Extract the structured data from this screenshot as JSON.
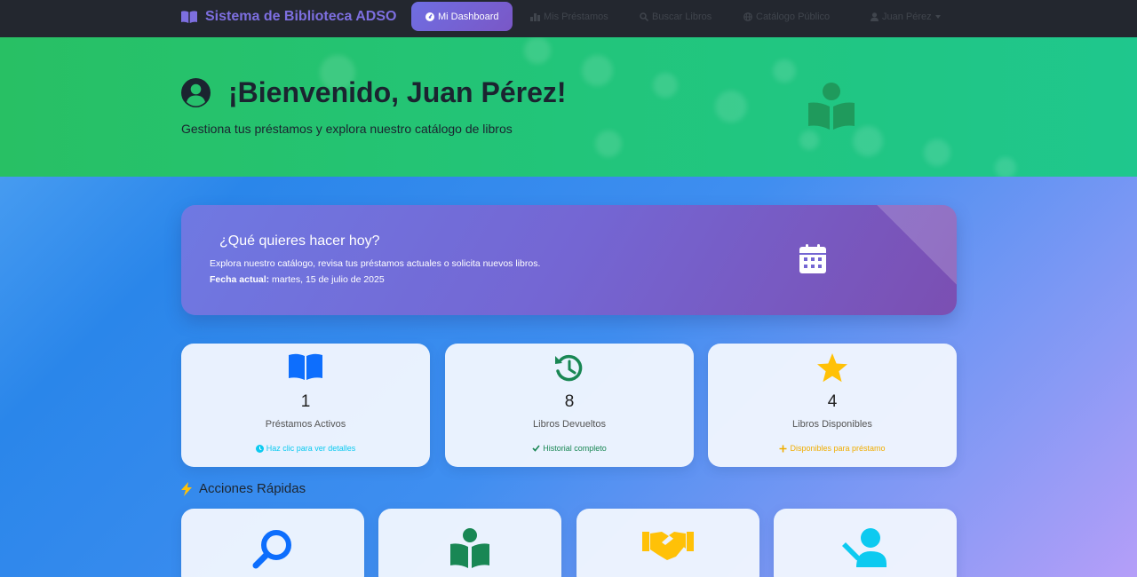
{
  "navbar": {
    "brand": "Sistema de Biblioteca ADSO",
    "items": [
      {
        "label": "Mi Dashboard",
        "icon": "dashboard-icon",
        "active": true
      },
      {
        "label": "Mis Préstamos",
        "icon": "chart-icon"
      },
      {
        "label": "Buscar Libros",
        "icon": "search-icon"
      },
      {
        "label": "Catálogo Público",
        "icon": "globe-icon"
      },
      {
        "label": "Juan Pérez",
        "icon": "user-icon",
        "dropdown": true
      }
    ]
  },
  "hero": {
    "title": "¡Bienvenido, Juan Pérez!",
    "subtitle": "Gestiona tus préstamos y explora nuestro catálogo de libros"
  },
  "welcome": {
    "title": "¿Qué quieres hacer hoy?",
    "text": "Explora nuestro catálogo, revisa tus préstamos actuales o solicita nuevos libros.",
    "date_label": "Fecha actual:",
    "date_value": "martes, 15 de julio de 2025"
  },
  "stats": [
    {
      "value": "1",
      "label": "Préstamos Activos",
      "footer": "Haz clic para ver detalles",
      "icon": "book-open-icon",
      "color": "#0d6efd",
      "footer_color": "#0dcaf0"
    },
    {
      "value": "8",
      "label": "Libros Devueltos",
      "footer": "Historial completo",
      "icon": "history-icon",
      "color": "#198754",
      "footer_color": "#198754"
    },
    {
      "value": "4",
      "label": "Libros Disponibles",
      "footer": "Disponibles para préstamo",
      "icon": "star-icon",
      "color": "#ffc107",
      "footer_color": "#f0ad00"
    }
  ],
  "quick_actions": {
    "title": "Acciones Rápidas",
    "items": [
      {
        "icon": "search-icon",
        "color": "#0d6efd"
      },
      {
        "icon": "book-reader-icon",
        "color": "#198754"
      },
      {
        "icon": "handshake-icon",
        "color": "#ffc107"
      },
      {
        "icon": "user-edit-icon",
        "color": "#0dcaf0"
      }
    ]
  }
}
